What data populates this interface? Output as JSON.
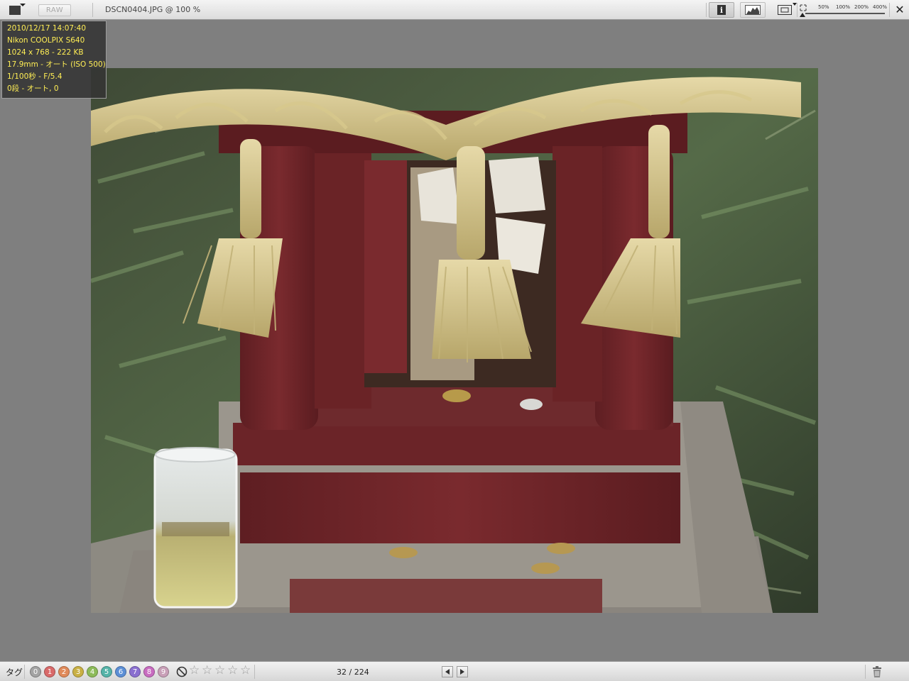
{
  "toolbar": {
    "raw_label": "RAW",
    "title": "DSCN0404.JPG @ 100 %",
    "zoom_levels": [
      "50%",
      "100%",
      "200%",
      "400%"
    ],
    "close_glyph": "✕",
    "icons": {
      "view_mode": "view-mode-icon",
      "info": "info-icon",
      "histogram": "histogram-icon",
      "fit": "fit-to-window-icon"
    }
  },
  "exif": {
    "datetime": "2010/12/17 14:07:40",
    "camera": "Nikon COOLPIX S640",
    "dimensions_size": "1024 x 768 - 222 KB",
    "lens_iso": "17.9mm - オート (ISO 500)",
    "shutter_aperture": "1/100秒 - F/5.4",
    "exposure": "0段 - オート, 0"
  },
  "bottombar": {
    "tag_label": "タグ",
    "tags": [
      {
        "label": "0",
        "color": "#a4a4a4"
      },
      {
        "label": "1",
        "color": "#d96a6a"
      },
      {
        "label": "2",
        "color": "#e08a5a"
      },
      {
        "label": "3",
        "color": "#c9b044"
      },
      {
        "label": "4",
        "color": "#8dbb5a"
      },
      {
        "label": "5",
        "color": "#55b3a8"
      },
      {
        "label": "6",
        "color": "#5c8fd6"
      },
      {
        "label": "7",
        "color": "#8a6fd0"
      },
      {
        "label": "8",
        "color": "#c86cc0"
      },
      {
        "label": "9",
        "color": "#c9a0b8"
      }
    ],
    "rating": {
      "value": 0,
      "max": 5
    },
    "counter": "32 / 224",
    "icons": {
      "prev": "previous-icon",
      "next": "next-icon",
      "trash": "trash-icon",
      "no_rating": "no-rating-icon"
    }
  },
  "photo": {
    "alt": "Small red wooden shrine with straw rope, coins and a glass jar"
  }
}
